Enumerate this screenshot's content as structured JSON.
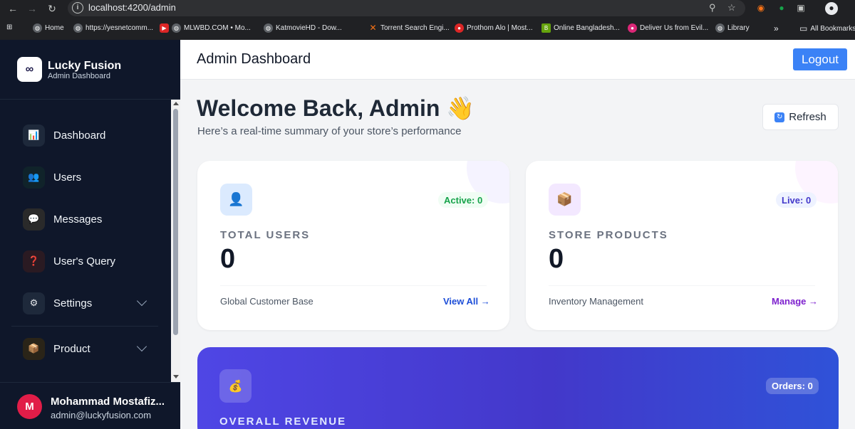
{
  "browser": {
    "url": "localhost:4200/admin",
    "bookmarks": [
      "Home",
      "https://yesnetcomm...",
      "MLWBD.COM • Mo...",
      "KatmovieHD - Dow...",
      "Torrent Search Engi...",
      "Prothom Alo | Most...",
      "Online Bangladesh...",
      "Deliver Us from Evil...",
      "Library"
    ],
    "all_bookmarks": "All Bookmarks"
  },
  "brand": {
    "name": "Lucky Fusion",
    "subtitle": "Admin Dashboard",
    "logo_glyph": "∞"
  },
  "sidebar": {
    "items": [
      {
        "label": "Dashboard",
        "icon": "chart-icon",
        "glyph": "📊"
      },
      {
        "label": "Users",
        "icon": "users-icon",
        "glyph": "👥"
      },
      {
        "label": "Messages",
        "icon": "message-icon",
        "glyph": "💬"
      },
      {
        "label": "User's Query",
        "icon": "question-icon",
        "glyph": "❓"
      },
      {
        "label": "Settings",
        "icon": "gear-icon",
        "glyph": "⚙"
      },
      {
        "label": "Product",
        "icon": "box-icon",
        "glyph": "📦"
      }
    ]
  },
  "profile": {
    "initial": "M",
    "name": "Mohammad Mostafiz...",
    "email": "admin@luckyfusion.com"
  },
  "header": {
    "title": "Admin Dashboard",
    "logout_label": "Logout"
  },
  "welcome": {
    "title": "Welcome Back, Admin 👋",
    "subtitle": "Here’s a real-time summary of your store’s performance",
    "refresh_label": "Refresh"
  },
  "cards": {
    "users": {
      "badge": "Active: 0",
      "label": "TOTAL USERS",
      "value": "0",
      "caption": "Global Customer Base",
      "link": "View All →",
      "glyph": "👤"
    },
    "products": {
      "badge": "Live: 0",
      "label": "STORE PRODUCTS",
      "value": "0",
      "caption": "Inventory Management",
      "link": "Manage →",
      "glyph": "📦"
    },
    "revenue": {
      "badge": "Orders: 0",
      "label": "OVERALL REVENUE",
      "glyph": "💰"
    }
  },
  "colors": {
    "accent_blue": "#3b82f6",
    "sidebar_bg": "#0f172a",
    "users_link": "#1d4ed8",
    "products_link": "#7e22ce",
    "active_badge_text": "#16a34a",
    "revenue_gradient_start": "#4f46e5"
  }
}
